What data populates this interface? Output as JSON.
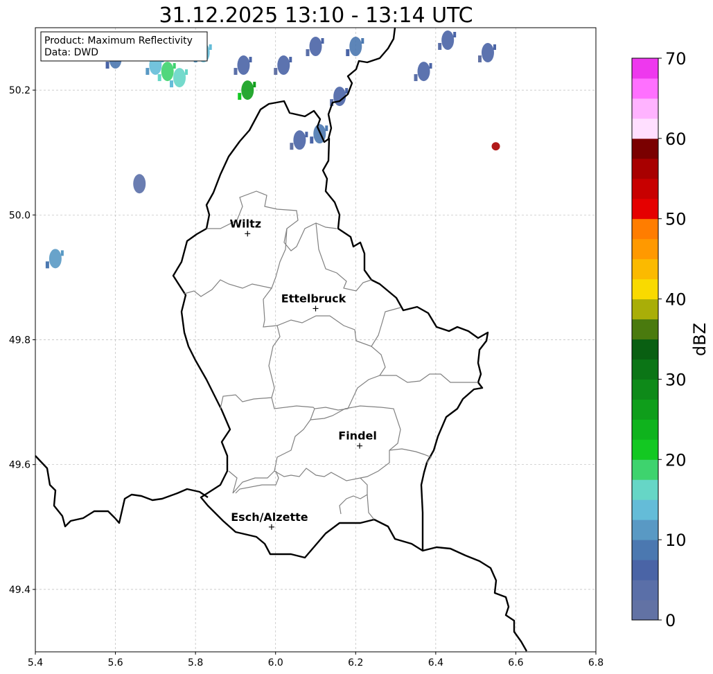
{
  "title": "31.12.2025 13:10 - 13:14 UTC",
  "info_box": {
    "line1": "Product: Maximum Reflectivity",
    "line2": "Data: DWD"
  },
  "map": {
    "lon_range": [
      5.4,
      6.8
    ],
    "lat_range": [
      49.3,
      50.3
    ],
    "x_ticks": [
      "5.4",
      "5.6",
      "5.8",
      "6.0",
      "6.2",
      "6.4",
      "6.6",
      "6.8"
    ],
    "y_ticks": [
      "50.2",
      "50.0",
      "49.8",
      "49.6",
      "49.4"
    ],
    "grid": true
  },
  "cities": [
    {
      "name": "Wiltz",
      "lon": 5.93,
      "lat": 49.97
    },
    {
      "name": "Ettelbruck",
      "lon": 6.1,
      "lat": 49.85
    },
    {
      "name": "Findel",
      "lon": 6.21,
      "lat": 49.63
    },
    {
      "name": "Esch/Alzette",
      "lon": 5.99,
      "lat": 49.5
    }
  ],
  "colorbar": {
    "label": "dBZ",
    "ticks": [
      "0",
      "10",
      "20",
      "30",
      "40",
      "50",
      "60",
      "70"
    ],
    "range": [
      0,
      70
    ],
    "colors": [
      "#6272a4",
      "#5a6fa8",
      "#4a64a6",
      "#4b78b0",
      "#5999c4",
      "#64bcd8",
      "#66d6c6",
      "#3ed36e",
      "#13c822",
      "#0fb31d",
      "#0f9e1b",
      "#0e8a19",
      "#0b7516",
      "#095f12",
      "#4a7a0e",
      "#a9ae08",
      "#f9da00",
      "#fbba00",
      "#ff9900",
      "#ff7d00",
      "#e50000",
      "#c80000",
      "#a80000",
      "#7a0000",
      "#ffdfff",
      "#ffb3ff",
      "#ff70ff",
      "#ee38ee"
    ]
  },
  "chart_data": {
    "type": "heatmap",
    "title": "31.12.2025 13:10 - 13:14 UTC",
    "ylabel_colorbar": "dBZ",
    "xlim": [
      5.4,
      6.8
    ],
    "ylim": [
      49.3,
      50.3
    ],
    "echo_cells": [
      {
        "lon": 5.6,
        "lat": 50.25,
        "dbz": 8
      },
      {
        "lon": 5.7,
        "lat": 50.24,
        "dbz": 14
      },
      {
        "lon": 5.73,
        "lat": 50.23,
        "dbz": 18
      },
      {
        "lon": 5.76,
        "lat": 50.22,
        "dbz": 16
      },
      {
        "lon": 5.82,
        "lat": 50.26,
        "dbz": 13
      },
      {
        "lon": 5.92,
        "lat": 50.24,
        "dbz": 6
      },
      {
        "lon": 5.93,
        "lat": 50.2,
        "dbz": 25
      },
      {
        "lon": 6.02,
        "lat": 50.24,
        "dbz": 5
      },
      {
        "lon": 6.1,
        "lat": 50.27,
        "dbz": 7
      },
      {
        "lon": 6.11,
        "lat": 50.13,
        "dbz": 8
      },
      {
        "lon": 6.16,
        "lat": 50.19,
        "dbz": 6
      },
      {
        "lon": 6.06,
        "lat": 50.12,
        "dbz": 5
      },
      {
        "lon": 6.2,
        "lat": 50.27,
        "dbz": 8
      },
      {
        "lon": 6.37,
        "lat": 50.23,
        "dbz": 6
      },
      {
        "lon": 6.43,
        "lat": 50.28,
        "dbz": 7
      },
      {
        "lon": 6.53,
        "lat": 50.26,
        "dbz": 5
      },
      {
        "lon": 6.55,
        "lat": 50.11,
        "dbz": 55
      },
      {
        "lon": 5.66,
        "lat": 50.05,
        "dbz": 3
      },
      {
        "lon": 5.45,
        "lat": 49.93,
        "dbz": 12
      }
    ]
  }
}
